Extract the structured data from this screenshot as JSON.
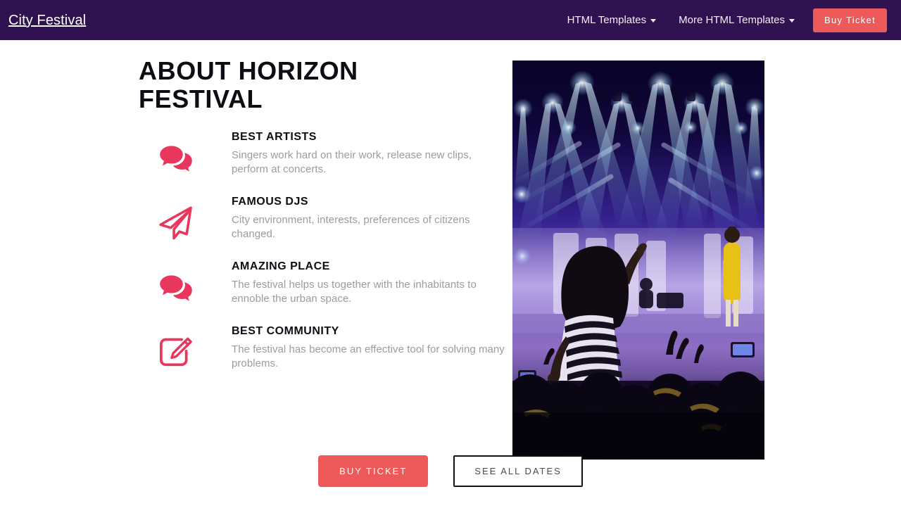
{
  "navbar": {
    "brand": "City Festival",
    "links": [
      {
        "label": "HTML Templates",
        "icon": "chevron-down-icon"
      },
      {
        "label": "More HTML Templates",
        "icon": "chevron-down-icon"
      }
    ],
    "cta_label": "Buy Ticket",
    "background_color": "#2F1351",
    "cta_color": "#EE5A5A"
  },
  "main": {
    "heading": "About Horizon Festival",
    "accent_color": "#E8365D",
    "features": [
      {
        "icon": "chat-bubbles-icon",
        "title": "Best Artists",
        "description": "Singers work hard on their work, release new clips, perform at concerts."
      },
      {
        "icon": "paper-plane-icon",
        "title": "Famous DJs",
        "description": "City environment, interests, preferences of citizens changed."
      },
      {
        "icon": "chat-bubbles-icon",
        "title": "Amazing Place",
        "description": "The festival helps us together with the inhabitants to ennoble the urban space."
      },
      {
        "icon": "edit-square-icon",
        "title": "Best Community",
        "description": "The festival has become an effective tool for solving many problems."
      }
    ],
    "photo": {
      "alt": "concert-stage-crowd-photo"
    }
  },
  "cta": {
    "buy_label": "BUY TICKET",
    "dates_label": "SEE ALL DATES"
  }
}
